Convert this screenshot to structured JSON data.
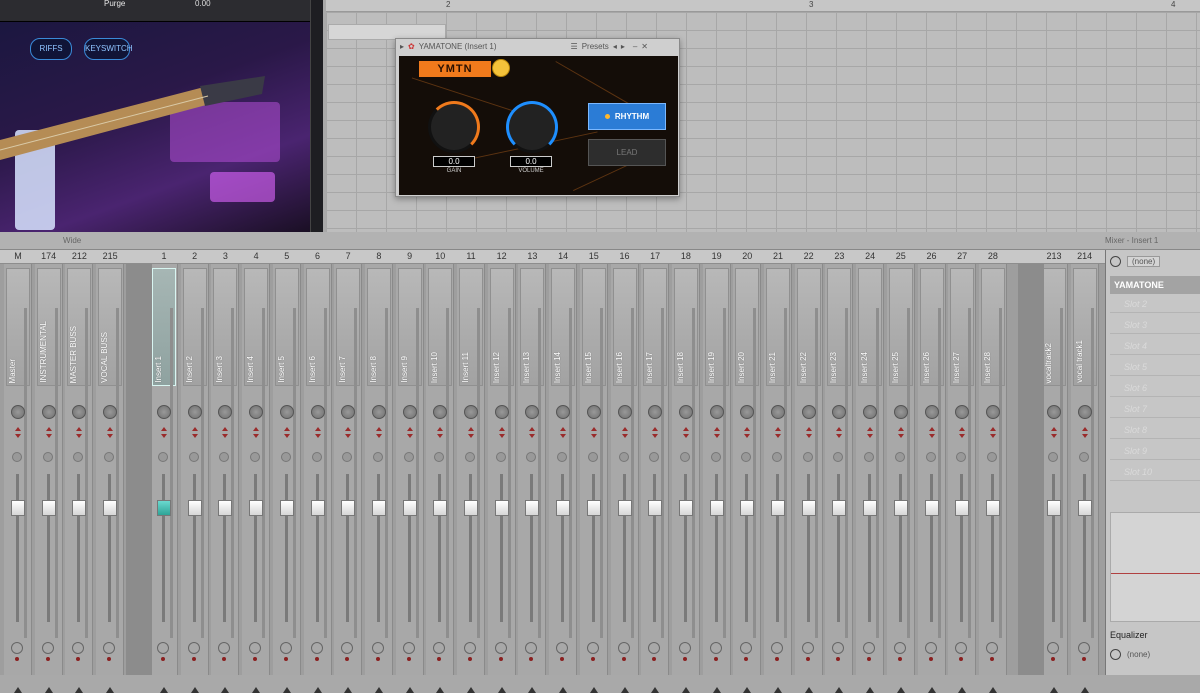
{
  "instrument": {
    "preset_label": "Purge",
    "value_readout": "0.00",
    "buttons": [
      "RIFFS",
      "KEYSWITCH"
    ]
  },
  "playlist": {
    "bar_numbers": [
      "2",
      "3",
      "4"
    ]
  },
  "plugin": {
    "title": "YAMATONE (Insert 1)",
    "presets_label": "Presets",
    "logo_text": "YMTN",
    "gain_value": "0.0",
    "gain_label": "GAIN",
    "volume_value": "0.0",
    "volume_label": "VOLUME",
    "rhythm_label": "RHYTHM",
    "lead_label": "LEAD",
    "accent_orange": "#f07a1c",
    "accent_blue": "#2b7cd6"
  },
  "mixer": {
    "title": "Wide",
    "panel_title": "Mixer - Insert 1",
    "track_numbers": [
      "M",
      "174",
      "212",
      "215",
      "1",
      "2",
      "3",
      "4",
      "5",
      "6",
      "7",
      "8",
      "9",
      "10",
      "11",
      "12",
      "13",
      "14",
      "15",
      "16",
      "17",
      "18",
      "19",
      "20",
      "21",
      "22",
      "23",
      "24",
      "25",
      "26",
      "27",
      "28",
      "213",
      "214"
    ],
    "tracks": [
      "Master",
      "INSTRUMENTAL",
      "MASTER BUSS",
      "VOCAL BUSS",
      "Insert 1",
      "Insert 2",
      "Insert 3",
      "Insert 4",
      "Insert 5",
      "Insert 6",
      "Insert 7",
      "Insert 8",
      "Insert 9",
      "Insert 10",
      "Insert 11",
      "Insert 12",
      "Insert 13",
      "Insert 14",
      "Insert 15",
      "Insert 16",
      "Insert 17",
      "Insert 18",
      "Insert 19",
      "Insert 20",
      "Insert 21",
      "Insert 22",
      "Insert 23",
      "Insert 24",
      "Insert 25",
      "Insert 26",
      "Insert 27",
      "Insert 28",
      "vocaltrack2",
      "vocal track1"
    ],
    "selected_track": "Insert 1"
  },
  "insert_panel": {
    "input": "(none)",
    "slot_main": "YAMATONE",
    "slots": [
      "Slot 2",
      "Slot 3",
      "Slot 4",
      "Slot 5",
      "Slot 6",
      "Slot 7",
      "Slot 8",
      "Slot 9",
      "Slot 10"
    ],
    "eq_label": "Equalizer",
    "output": "(none)"
  }
}
